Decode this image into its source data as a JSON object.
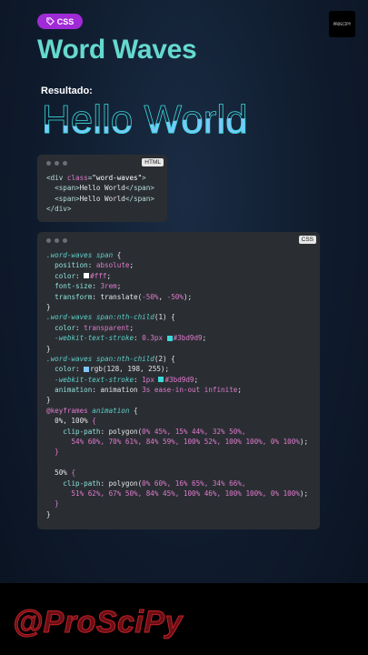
{
  "badge": {
    "label": "CSS",
    "icon": "tag-icon"
  },
  "logo": {
    "text": "PROSCIPY"
  },
  "title": "Word Waves",
  "result_label": "Resultado:",
  "preview_text": "Hello World",
  "html_card": {
    "lang": "HTML",
    "lines": [
      [
        [
          "t-tag",
          "<div "
        ],
        [
          "t-attr",
          "class"
        ],
        [
          "t-tag",
          "="
        ],
        [
          "t-str",
          "\"word-waves\""
        ],
        [
          "t-tag",
          ">"
        ]
      ],
      [
        [
          "t-plain",
          "  "
        ],
        [
          "t-tag",
          "<span>"
        ],
        [
          "t-plain",
          "Hello World"
        ],
        [
          "t-tag",
          "</span>"
        ]
      ],
      [
        [
          "t-plain",
          "  "
        ],
        [
          "t-tag",
          "<span>"
        ],
        [
          "t-plain",
          "Hello World"
        ],
        [
          "t-tag",
          "</span>"
        ]
      ],
      [
        [
          "t-tag",
          "</div>"
        ]
      ]
    ]
  },
  "css_card": {
    "lang": "CSS",
    "lines": [
      [
        [
          "t-sel",
          ".word-waves span"
        ],
        [
          "t-plain",
          " {"
        ]
      ],
      [
        [
          "t-plain",
          "  "
        ],
        [
          "t-prop",
          "position"
        ],
        [
          "t-plain",
          ": "
        ],
        [
          "t-val",
          "absolute"
        ],
        [
          "t-plain",
          ";"
        ]
      ],
      [
        [
          "t-plain",
          "  "
        ],
        [
          "t-prop",
          "color"
        ],
        [
          "t-plain",
          ": "
        ],
        [
          "sw",
          "#ffffff"
        ],
        [
          "t-val",
          "#fff"
        ],
        [
          "t-plain",
          ";"
        ]
      ],
      [
        [
          "t-plain",
          "  "
        ],
        [
          "t-prop",
          "font-size"
        ],
        [
          "t-plain",
          ": "
        ],
        [
          "t-val",
          "3rem"
        ],
        [
          "t-plain",
          ";"
        ]
      ],
      [
        [
          "t-plain",
          "  "
        ],
        [
          "t-prop",
          "transform"
        ],
        [
          "t-plain",
          ": translate("
        ],
        [
          "t-val",
          "-50%"
        ],
        [
          "t-plain",
          ", "
        ],
        [
          "t-val",
          "-50%"
        ],
        [
          "t-plain",
          ");"
        ]
      ],
      [
        [
          "t-plain",
          "}"
        ]
      ],
      [
        [
          "t-sel",
          ".word-waves span:nth-child"
        ],
        [
          "t-plain",
          "(1) {"
        ]
      ],
      [
        [
          "t-plain",
          "  "
        ],
        [
          "t-prop",
          "color"
        ],
        [
          "t-plain",
          ": "
        ],
        [
          "t-val",
          "transparent"
        ],
        [
          "t-plain",
          ";"
        ]
      ],
      [
        [
          "t-plain",
          "  "
        ],
        [
          "t-sel",
          "-webkit-text-stroke"
        ],
        [
          "t-plain",
          ": "
        ],
        [
          "t-val",
          "0.3px "
        ],
        [
          "sw",
          "#3bd9d9"
        ],
        [
          "t-val",
          "#3bd9d9"
        ],
        [
          "t-plain",
          ";"
        ]
      ],
      [
        [
          "t-plain",
          "}"
        ]
      ],
      [
        [
          "t-sel",
          ".word-waves span:nth-child"
        ],
        [
          "t-plain",
          "(2) {"
        ]
      ],
      [
        [
          "t-plain",
          "  "
        ],
        [
          "t-prop",
          "color"
        ],
        [
          "t-plain",
          ": "
        ],
        [
          "sw",
          "#80c6ff"
        ],
        [
          "t-plain",
          "rgb(128, 198, 255);"
        ]
      ],
      [
        [
          "t-plain",
          "  "
        ],
        [
          "t-sel",
          "-webkit-text-stroke"
        ],
        [
          "t-plain",
          ": "
        ],
        [
          "t-val",
          "1px "
        ],
        [
          "sw",
          "#3bd9d9"
        ],
        [
          "t-val",
          "#3bd9d9"
        ],
        [
          "t-plain",
          ";"
        ]
      ],
      [
        [
          "t-plain",
          "  "
        ],
        [
          "t-prop",
          "animation"
        ],
        [
          "t-plain",
          ": animation "
        ],
        [
          "t-val",
          "3s ease-in-out infinite"
        ],
        [
          "t-plain",
          ";"
        ]
      ],
      [
        [
          "t-plain",
          "}"
        ]
      ],
      [
        [
          "t-val",
          "@keyframes "
        ],
        [
          "t-sel",
          "animation"
        ],
        [
          "t-plain",
          " {"
        ]
      ],
      [
        [
          "t-plain",
          "  0%, 100% "
        ],
        [
          "t-val",
          "{"
        ]
      ],
      [
        [
          "t-plain",
          "    "
        ],
        [
          "t-prop",
          "clip-path"
        ],
        [
          "t-plain",
          ": polygon("
        ],
        [
          "t-val",
          "0% 45%, 15% 44%, 32% 50%,"
        ]
      ],
      [
        [
          "t-plain",
          "      "
        ],
        [
          "t-val",
          "54% 60%, 70% 61%, 84% 59%, 100% 52%, 100% 100%, 0% 100%"
        ],
        [
          "t-plain",
          ");"
        ]
      ],
      [
        [
          "t-plain",
          "  "
        ],
        [
          "t-val",
          "}"
        ]
      ],
      [
        [
          "t-plain",
          ""
        ]
      ],
      [
        [
          "t-plain",
          "  50% "
        ],
        [
          "t-val",
          "{"
        ]
      ],
      [
        [
          "t-plain",
          "    "
        ],
        [
          "t-prop",
          "clip-path"
        ],
        [
          "t-plain",
          ": polygon("
        ],
        [
          "t-val",
          "0% 60%, 16% 65%, 34% 66%,"
        ]
      ],
      [
        [
          "t-plain",
          "      "
        ],
        [
          "t-val",
          "51% 62%, 67% 50%, 84% 45%, 100% 46%, 100% 100%, 0% 100%"
        ],
        [
          "t-plain",
          ");"
        ]
      ],
      [
        [
          "t-plain",
          "  "
        ],
        [
          "t-val",
          "}"
        ]
      ],
      [
        [
          "t-plain",
          "}"
        ]
      ]
    ]
  },
  "footer_handle": "@ProSciPy"
}
